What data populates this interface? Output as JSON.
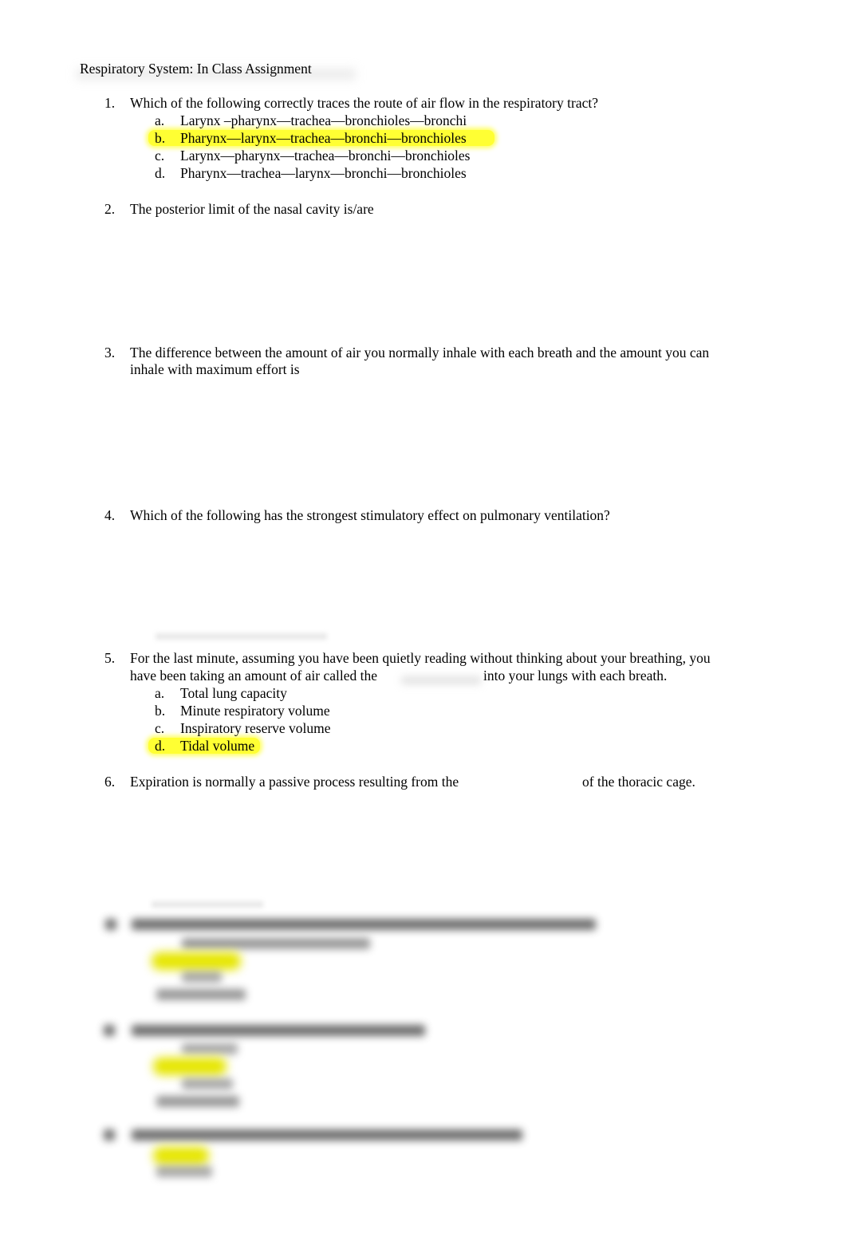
{
  "document": {
    "title": "Respiratory System: In Class Assignment",
    "highlight_color": "#ffff33"
  },
  "questions": [
    {
      "number": "1.",
      "text": "Which of the following correctly traces the route of air flow in the respiratory tract?",
      "options": [
        {
          "letter": "a.",
          "text": "Larynx –pharynx—trachea—bronchioles—bronchi",
          "highlighted": false
        },
        {
          "letter": "b.",
          "text": "Pharynx—larynx—trachea—bronchi—bronchioles",
          "highlighted": true
        },
        {
          "letter": "c.",
          "text": "Larynx—pharynx—trachea—bronchi—bronchioles",
          "highlighted": false
        },
        {
          "letter": "d.",
          "text": "Pharynx—trachea—larynx—bronchi—bronchioles",
          "highlighted": false
        }
      ]
    },
    {
      "number": "2.",
      "text": "The posterior limit of the nasal cavity is/are"
    },
    {
      "number": "3.",
      "line1": "The difference between the amount of air you normally inhale with each breath and the amount you can",
      "line2": "inhale with maximum effort is"
    },
    {
      "number": "4.",
      "text": "Which of the following has the strongest stimulatory effect on pulmonary ventilation?"
    },
    {
      "number": "5.",
      "line1": "For the last minute, assuming you have been quietly reading without thinking about your breathing, you",
      "line2_before": "have been taking an amount of air called the",
      "line2_after": "into your lungs with each breath.",
      "options": [
        {
          "letter": "a.",
          "text": "Total lung capacity",
          "highlighted": false
        },
        {
          "letter": "b.",
          "text": "Minute respiratory volume",
          "highlighted": false
        },
        {
          "letter": "c.",
          "text": "Inspiratory reserve volume",
          "highlighted": false
        },
        {
          "letter": "d.",
          "text": "Tidal volume",
          "highlighted": true
        }
      ]
    },
    {
      "number": "6.",
      "text_before": "Expiration is normally a passive process resulting from the",
      "text_after": "of the thoracic cage."
    }
  ],
  "obscured_section": {
    "note": "Questions 7–9 are blurred and unreadable",
    "blurred_question_count": 3
  }
}
